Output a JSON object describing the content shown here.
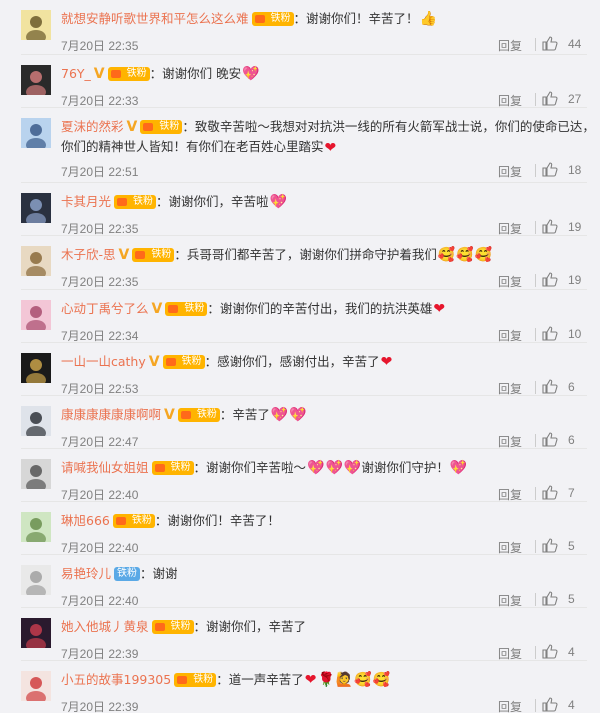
{
  "colors": {
    "username": "#eb7350",
    "heart": "#e6162d",
    "fan_badge": "#ffb400",
    "fan_badge_blue": "#5aa9e6"
  },
  "labels": {
    "reply": "回复",
    "fan_badge": "铁粉"
  },
  "comments": [
    {
      "user": "就想安静听歌世界和平怎么这么难",
      "vip": false,
      "fan_badge": true,
      "text": "：谢谢你们！辛苦了！",
      "emojis": [
        "thumbs-up"
      ],
      "time": "7月20日 22:35",
      "likes": "44"
    },
    {
      "user": "76Y_",
      "vip": true,
      "fan_badge": true,
      "text": "：谢谢你们 晚安",
      "emojis": [
        "heart-gift"
      ],
      "time": "7月20日 22:33",
      "likes": "27"
    },
    {
      "user": "夏沫的然彩",
      "vip": true,
      "fan_badge": true,
      "text": "：致敬辛苦啦～我想对对抗洪一线的所有火箭军战士说，你们的使命已达，",
      "text2": "你们的精神世人皆知！有你们在老百姓心里踏实",
      "emojis": [
        "red-heart"
      ],
      "time": "7月20日 22:51",
      "likes": "18"
    },
    {
      "user": "卡其月光",
      "vip": false,
      "fan_badge": true,
      "text": "：谢谢你们，辛苦啦",
      "emojis": [
        "heart-gift"
      ],
      "time": "7月20日 22:35",
      "likes": "19"
    },
    {
      "user": "木子欣-思",
      "vip": true,
      "fan_badge": true,
      "text": "：兵哥哥们都辛苦了，谢谢你们拼命守护着我们",
      "emojis": [
        "smile-hearts",
        "smile-hearts",
        "smile-hearts"
      ],
      "time": "7月20日 22:35",
      "likes": "19"
    },
    {
      "user": "心动丁禹兮了么",
      "vip": true,
      "fan_badge": true,
      "text": "：谢谢你们的辛苦付出，我们的抗洪英雄",
      "emojis": [
        "red-heart"
      ],
      "time": "7月20日 22:34",
      "likes": "10"
    },
    {
      "user": "一山一山cathy",
      "vip": true,
      "fan_badge": true,
      "text": "：感谢你们，感谢付出，辛苦了",
      "emojis": [
        "red-heart"
      ],
      "time": "7月20日 22:53",
      "likes": "6"
    },
    {
      "user": "康康康康康康啊啊",
      "vip": true,
      "fan_badge": true,
      "text": "：辛苦了",
      "emojis": [
        "heart-gift",
        "heart-gift"
      ],
      "time": "7月20日 22:47",
      "likes": "6"
    },
    {
      "user": "请喊我仙女姐姐",
      "vip": false,
      "fan_badge": true,
      "text": "：谢谢你们辛苦啦～",
      "emojis": [
        "heart-gift",
        "heart-gift",
        "heart-gift"
      ],
      "text_after": "谢谢你们守护！",
      "emojis_after": [
        "heart-gift"
      ],
      "time": "7月20日 22:40",
      "likes": "7"
    },
    {
      "user": "琳旭666",
      "vip": false,
      "fan_badge": true,
      "text": "：谢谢你们！辛苦了！",
      "emojis": [],
      "time": "7月20日 22:40",
      "likes": "5"
    },
    {
      "user": "易艳玲儿",
      "vip": false,
      "fan_badge": "blue",
      "text": "：谢谢",
      "emojis": [],
      "time": "7月20日 22:40",
      "likes": "5"
    },
    {
      "user": "她入他城丿黄泉",
      "vip": false,
      "fan_badge": true,
      "text": "：谢谢你们，辛苦了",
      "emojis": [],
      "time": "7月20日 22:39",
      "likes": "4"
    },
    {
      "user": "小五的故事199305",
      "vip": false,
      "fan_badge": true,
      "text": "：道一声辛苦了",
      "emojis": [
        "red-heart",
        "rose",
        "person-raising-hand",
        "smile-hearts",
        "smile-hearts"
      ],
      "time": "7月20日 22:39",
      "likes": "4"
    }
  ]
}
